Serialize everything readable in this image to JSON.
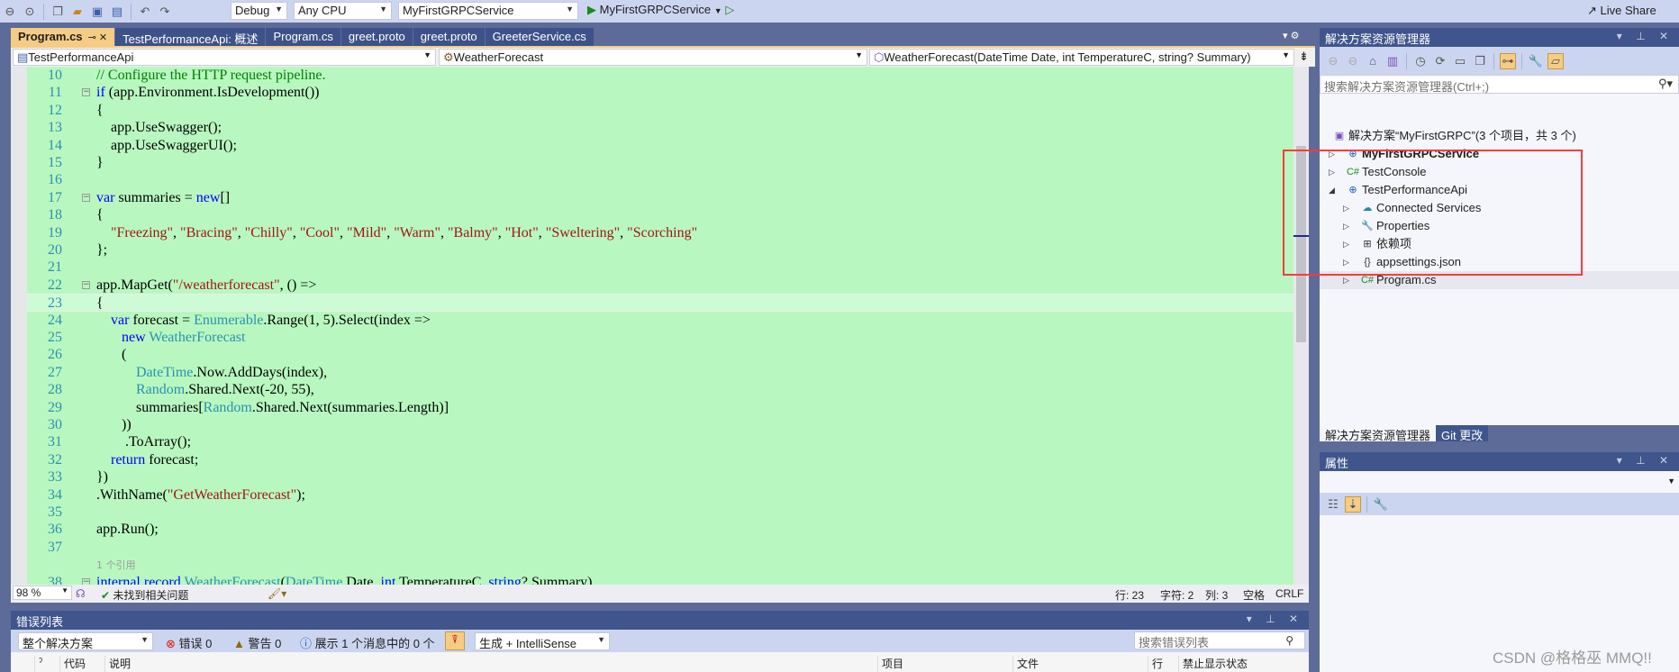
{
  "colors": {
    "accent_tab": "#f5cc84",
    "panel_title": "#3f558c",
    "editor_bg": "#b8f8c0",
    "keyword": "#0000ff",
    "type": "#2b91af",
    "string": "#a31515",
    "comment": "#008000",
    "highlight_box": "#ff3a3a"
  },
  "toolbar": {
    "config": "Debug",
    "platform": "Any CPU",
    "startup_project": "MyFirstGRPCService",
    "run_label": "MyFirstGRPCService",
    "live_share": "Live Share",
    "icons": [
      "back-icon",
      "forward-icon",
      "new-item-icon",
      "open-folder-icon",
      "save-icon",
      "save-all-icon",
      "undo-icon",
      "redo-icon"
    ]
  },
  "tabs": [
    {
      "label": "Program.cs",
      "active": true
    },
    {
      "label": "TestPerformanceApi: 概述"
    },
    {
      "label": "Program.cs"
    },
    {
      "label": "greet.proto"
    },
    {
      "label": "greet.proto"
    },
    {
      "label": "GreeterService.cs"
    }
  ],
  "navbar": {
    "project": "TestPerformanceApi",
    "type": "WeatherForecast",
    "member": "WeatherForecast(DateTime Date, int TemperatureC, string? Summary)"
  },
  "code": {
    "current_line": 23,
    "lines": [
      {
        "n": "10",
        "t": [
          [
            "// Configure the HTTP request pipeline.",
            "comment"
          ]
        ]
      },
      {
        "n": "11",
        "fold": true,
        "t": [
          [
            "if",
            "kw"
          ],
          [
            " (app.Environment.IsDevelopment())",
            "plain"
          ]
        ]
      },
      {
        "n": "12",
        "t": [
          [
            "{",
            "plain"
          ]
        ]
      },
      {
        "n": "13",
        "t": [
          [
            "    app.UseSwagger();",
            "plain"
          ]
        ]
      },
      {
        "n": "14",
        "t": [
          [
            "    app.UseSwaggerUI();",
            "plain"
          ]
        ]
      },
      {
        "n": "15",
        "t": [
          [
            "}",
            "plain"
          ]
        ]
      },
      {
        "n": "16",
        "t": []
      },
      {
        "n": "17",
        "fold": true,
        "t": [
          [
            "var",
            "kw"
          ],
          [
            " summaries = ",
            "plain"
          ],
          [
            "new",
            "kw"
          ],
          [
            "[]",
            "plain"
          ]
        ]
      },
      {
        "n": "18",
        "t": [
          [
            "{",
            "plain"
          ]
        ]
      },
      {
        "n": "19",
        "t": [
          [
            "    ",
            "plain"
          ],
          [
            "\"Freezing\"",
            "str"
          ],
          [
            ", ",
            "plain"
          ],
          [
            "\"Bracing\"",
            "str"
          ],
          [
            ", ",
            "plain"
          ],
          [
            "\"Chilly\"",
            "str"
          ],
          [
            ", ",
            "plain"
          ],
          [
            "\"Cool\"",
            "str"
          ],
          [
            ", ",
            "plain"
          ],
          [
            "\"Mild\"",
            "str"
          ],
          [
            ", ",
            "plain"
          ],
          [
            "\"Warm\"",
            "str"
          ],
          [
            ", ",
            "plain"
          ],
          [
            "\"Balmy\"",
            "str"
          ],
          [
            ", ",
            "plain"
          ],
          [
            "\"Hot\"",
            "str"
          ],
          [
            ", ",
            "plain"
          ],
          [
            "\"Sweltering\"",
            "str"
          ],
          [
            ", ",
            "plain"
          ],
          [
            "\"Scorching\"",
            "str"
          ]
        ]
      },
      {
        "n": "20",
        "t": [
          [
            "};",
            "plain"
          ]
        ]
      },
      {
        "n": "21",
        "t": []
      },
      {
        "n": "22",
        "fold": true,
        "t": [
          [
            "app.MapGet(",
            "plain"
          ],
          [
            "\"/weatherforecast\"",
            "str"
          ],
          [
            ", () =>",
            "plain"
          ]
        ]
      },
      {
        "n": "23",
        "t": [
          [
            "{",
            "plain"
          ]
        ]
      },
      {
        "n": "24",
        "t": [
          [
            "    ",
            "plain"
          ],
          [
            "var",
            "kw"
          ],
          [
            " forecast = ",
            "plain"
          ],
          [
            "Enumerable",
            "type"
          ],
          [
            ".Range(1, 5).Select(index =>",
            "plain"
          ]
        ]
      },
      {
        "n": "25",
        "t": [
          [
            "       ",
            "plain"
          ],
          [
            "new",
            "kw"
          ],
          [
            " ",
            "plain"
          ],
          [
            "WeatherForecast",
            "type"
          ]
        ]
      },
      {
        "n": "26",
        "t": [
          [
            "       (",
            "plain"
          ]
        ]
      },
      {
        "n": "27",
        "t": [
          [
            "           ",
            "plain"
          ],
          [
            "DateTime",
            "type"
          ],
          [
            ".Now.AddDays(index),",
            "plain"
          ]
        ]
      },
      {
        "n": "28",
        "t": [
          [
            "           ",
            "plain"
          ],
          [
            "Random",
            "type"
          ],
          [
            ".Shared.Next(-20, 55),",
            "plain"
          ]
        ]
      },
      {
        "n": "29",
        "t": [
          [
            "           summaries[",
            "plain"
          ],
          [
            "Random",
            "type"
          ],
          [
            ".Shared.Next(summaries.Length)]",
            "plain"
          ]
        ]
      },
      {
        "n": "30",
        "t": [
          [
            "       ))",
            "plain"
          ]
        ]
      },
      {
        "n": "31",
        "t": [
          [
            "        .ToArray();",
            "plain"
          ]
        ]
      },
      {
        "n": "32",
        "t": [
          [
            "    ",
            "plain"
          ],
          [
            "return",
            "kw"
          ],
          [
            " forecast;",
            "plain"
          ]
        ]
      },
      {
        "n": "33",
        "t": [
          [
            "})",
            "plain"
          ]
        ]
      },
      {
        "n": "34",
        "t": [
          [
            ".WithName(",
            "plain"
          ],
          [
            "\"GetWeatherForecast\"",
            "str"
          ],
          [
            ");",
            "plain"
          ]
        ]
      },
      {
        "n": "35",
        "t": []
      },
      {
        "n": "36",
        "t": [
          [
            "app.Run();",
            "plain"
          ]
        ]
      },
      {
        "n": "37",
        "t": []
      },
      {
        "n": "",
        "codelens": "1 个引用",
        "t": []
      },
      {
        "n": "38",
        "fold": true,
        "t": [
          [
            "internal",
            "kw"
          ],
          [
            " ",
            "plain"
          ],
          [
            "record",
            "kw"
          ],
          [
            " ",
            "plain"
          ],
          [
            "WeatherForecast",
            "type"
          ],
          [
            "(",
            "plain"
          ],
          [
            "DateTime",
            "type"
          ],
          [
            " Date, ",
            "plain"
          ],
          [
            "int",
            "kw"
          ],
          [
            " TemperatureC, ",
            "plain"
          ],
          [
            "string",
            "kw"
          ],
          [
            "? Summary)",
            "plain"
          ]
        ]
      }
    ]
  },
  "editor_status": {
    "zoom": "98 %",
    "issues": "未找到相关问题",
    "line": "行: 23",
    "char": "字符: 2",
    "col": "列: 3",
    "spaces": "空格",
    "eol": "CRLF"
  },
  "error_list": {
    "title": "错误列表",
    "scope": "整个解决方案",
    "errors": "错误 0",
    "warnings": "警告 0",
    "messages": "展示 1 个消息中的 0 个",
    "source": "生成 + IntelliSense",
    "search_placeholder": "搜索错误列表",
    "columns": [
      "代码",
      "说明",
      "项目",
      "文件",
      "行",
      "禁止显示状态"
    ]
  },
  "solution_explorer": {
    "title": "解决方案资源管理器",
    "search_placeholder": "搜索解决方案资源管理器(Ctrl+;)",
    "items": [
      {
        "label": "解决方案“MyFirstGRPC”(3 个项目，共 3 个)",
        "icon": "solution-icon",
        "expander": "none",
        "level": 0
      },
      {
        "label": "MyFirstGRPCService",
        "icon": "web-project-icon",
        "expander": "collapsed",
        "level": 0,
        "bold": true
      },
      {
        "label": "TestConsole",
        "icon": "csharp-project-icon",
        "expander": "collapsed",
        "level": 0
      },
      {
        "label": "TestPerformanceApi",
        "icon": "web-project-icon",
        "expander": "expanded",
        "level": 0
      },
      {
        "label": "Connected Services",
        "icon": "connected-services-icon",
        "expander": "collapsed",
        "level": 1
      },
      {
        "label": "Properties",
        "icon": "properties-icon",
        "expander": "collapsed",
        "level": 1
      },
      {
        "label": "依赖项",
        "icon": "dependencies-icon",
        "expander": "collapsed",
        "level": 1
      },
      {
        "label": "appsettings.json",
        "icon": "json-file-icon",
        "expander": "collapsed",
        "level": 1
      },
      {
        "label": "Program.cs",
        "icon": "csharp-file-icon",
        "expander": "collapsed",
        "level": 1,
        "selected": true
      }
    ],
    "bottom_tabs": [
      {
        "label": "解决方案资源管理器",
        "active": true
      },
      {
        "label": "Git 更改"
      }
    ]
  },
  "properties": {
    "title": "属性"
  },
  "watermark": "CSDN @格格巫 MMQ!!"
}
